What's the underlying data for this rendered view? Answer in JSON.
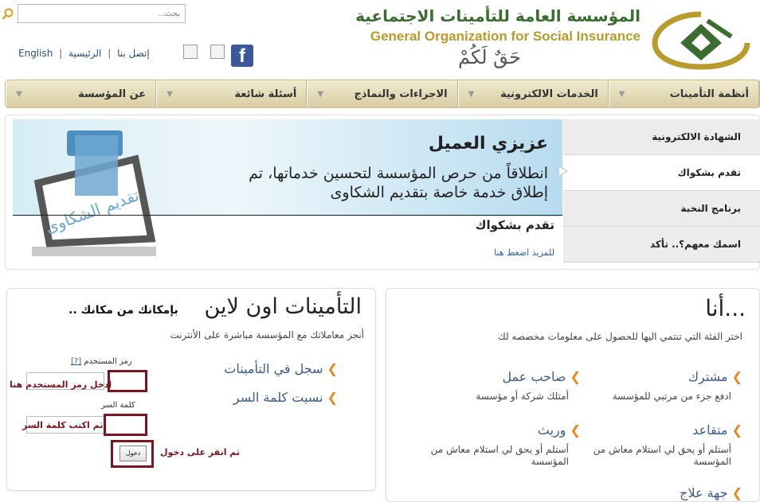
{
  "header": {
    "search_placeholder": "بحث...",
    "links": {
      "english": "English",
      "contact": "إتصل بنا",
      "home": "الرئيسية"
    },
    "logo_ar": "المؤسسة العامة للتأمينات الاجتماعية",
    "logo_en": "General Organization for Social Insurance",
    "slogan": "حَقٌ لَكُمْ",
    "facebook_glyph": "f"
  },
  "nav": {
    "items": [
      {
        "label": "أنظمة التأمينات"
      },
      {
        "label": "الخدمات الالكترونية"
      },
      {
        "label": "الاجراءات والنماذج"
      },
      {
        "label": "أسئلة شائعة"
      },
      {
        "label": "عن المؤسسة"
      }
    ]
  },
  "hero": {
    "title": "عزيزي العميل",
    "text": "انطلاقاً من حرص المؤسسة لتحسين خدماتها، تم إطلاق خدمة خاصة بتقديم الشكاوى",
    "caption": "تقدم بشكواك",
    "more_link": "للمزيد اضغط هنا",
    "box_art_text": "تقديم الشكاوى"
  },
  "side_menu": {
    "items": [
      {
        "label": "الشهادة الالكترونية"
      },
      {
        "label": "تقدم بشكواك"
      },
      {
        "label": "برنامج النخبة"
      },
      {
        "label": "اسمك معهم؟.. تأكد"
      }
    ]
  },
  "login": {
    "title": "التأمينات اون لاين",
    "subtitle": ".. بإمكانك من مكانك",
    "desc": "أنجز معاملاتك مع المؤسسة مباشرة على الأنترنت",
    "register_link": "سجل في التأمينات",
    "forgot_link": "نسيت كلمة السر",
    "username_label": "رمز المستخدم",
    "username_help": "[?]",
    "password_label": "كلمة السر",
    "login_button": "دخول",
    "note_username": "ادخل رمز المستخدم هنا",
    "note_password": "ثم اكتب كلمة السر",
    "note_button": "ثم انقر على دخول"
  },
  "iam": {
    "title": "أنا...",
    "desc": "اختر الفئة التي تنتمي اليها للحصول على معلومات مخصصه لك",
    "items": [
      {
        "title": "مشترك",
        "desc": "ادفع جزء من مرتبي للمؤسسة"
      },
      {
        "title": "صاحب عمل",
        "desc": "أمتلك شركة أو مؤسسة"
      },
      {
        "title": "متقاعد",
        "desc": "أستلم أو يحق لي استلام معاش من المؤسسة"
      },
      {
        "title": "وريث",
        "desc": "أستلم أو يحق لي استلام معاش من المؤسسة"
      },
      {
        "title": "جهة علاج",
        "desc": ""
      }
    ]
  },
  "colors": {
    "brand_green": "#3b6d31",
    "brand_gold": "#b99a2c",
    "link_blue": "#3b5b8a",
    "accent_orange": "#e8871e",
    "annotation_red": "#7a1520"
  }
}
